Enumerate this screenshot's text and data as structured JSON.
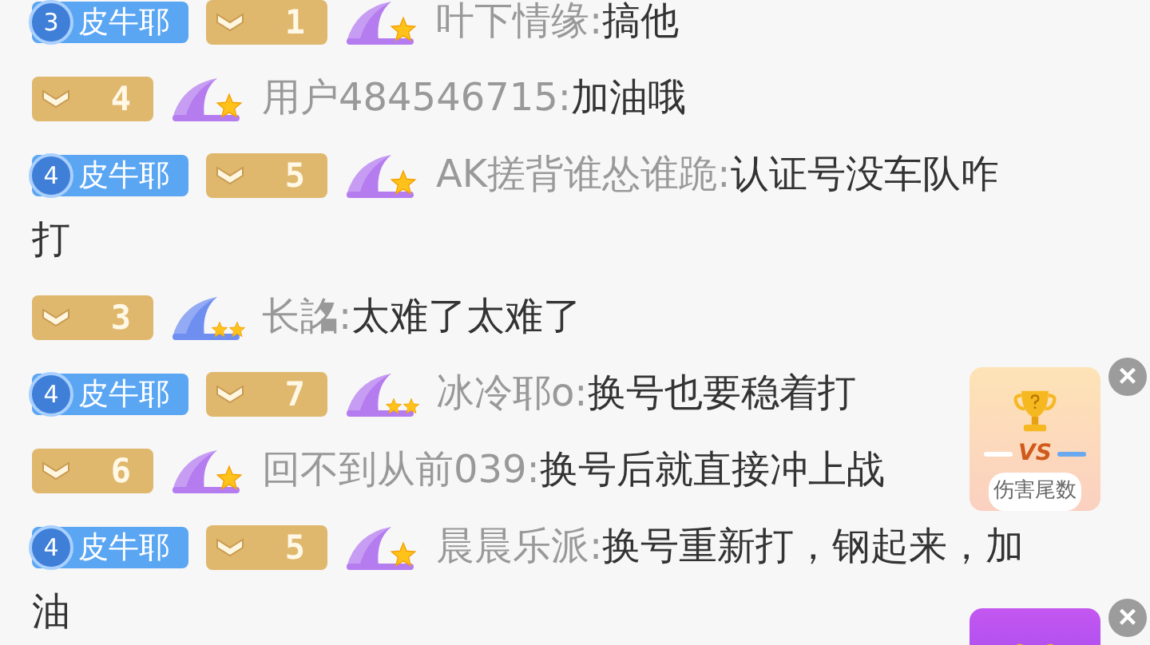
{
  "messages": [
    {
      "fan_badge": {
        "level": "3",
        "name": "皮牛耶"
      },
      "user_level": "1",
      "rank_icon": {
        "kind": "single",
        "color": "#b57cf0"
      },
      "username": "叶下情缘:",
      "text": "搞他"
    },
    {
      "user_level": "4",
      "rank_icon": {
        "kind": "single",
        "color": "#b57cf0"
      },
      "username": "用户484546715:",
      "text": "加油哦"
    },
    {
      "fan_badge": {
        "level": "4",
        "name": "皮牛耶"
      },
      "user_level": "5",
      "rank_icon": {
        "kind": "single",
        "color": "#b57cf0"
      },
      "username": "AK搓背谁怂谁跪:",
      "text": "认证号没车队咋",
      "text_continued": "打"
    },
    {
      "user_level": "3",
      "rank_icon": {
        "kind": "double",
        "color": "#6f8ff0"
      },
      "username": "长詺:",
      "text": "太难了太难了"
    },
    {
      "fan_badge": {
        "level": "4",
        "name": "皮牛耶"
      },
      "user_level": "7",
      "rank_icon": {
        "kind": "double",
        "color": "#b57cf0"
      },
      "username": "冰冷耶o:",
      "text": "换号也要稳着打"
    },
    {
      "user_level": "6",
      "rank_icon": {
        "kind": "single",
        "color": "#b57cf0"
      },
      "username": "回不到从前039:",
      "text": "换号后就直接冲上战"
    },
    {
      "fan_badge": {
        "level": "4",
        "name": "皮牛耶"
      },
      "user_level": "5",
      "rank_icon": {
        "kind": "single",
        "color": "#b57cf0"
      },
      "username": "晨晨乐派:",
      "text": "换号重新打，钢起来，加",
      "text_continued": "油"
    }
  ],
  "widgets": [
    {
      "kind": "pk",
      "vs": "VS",
      "label": "伤害尾数",
      "close": "×"
    },
    {
      "kind": "gift",
      "close": "×"
    }
  ]
}
